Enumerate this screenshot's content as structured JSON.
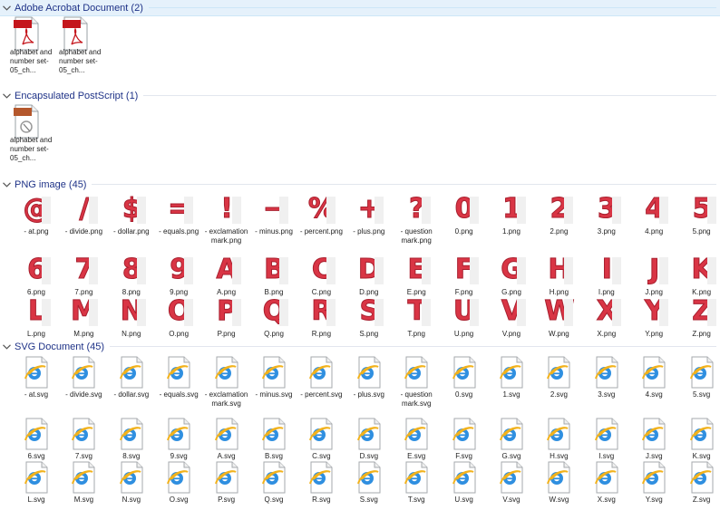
{
  "groups": [
    {
      "title": "Adobe Acrobat Document (2)"
    },
    {
      "title": "Encapsulated PostScript (1)"
    },
    {
      "title": "PNG image (45)"
    },
    {
      "title": "SVG Document (45)"
    }
  ],
  "pdf_items": [
    {
      "label": "alphabet and number set-05_ch...",
      "badge": "PDF"
    },
    {
      "label": "alphabet and number set-05_ch...",
      "badge": "PDF"
    }
  ],
  "eps_items": [
    {
      "label": "alphabet and number set-05_ch...",
      "badge": "EPS"
    }
  ],
  "png_items": [
    {
      "glyph": "@",
      "label": "- at.png"
    },
    {
      "glyph": "/",
      "label": "- divide.png"
    },
    {
      "glyph": "$",
      "label": "- dollar.png"
    },
    {
      "glyph": "=",
      "label": "- equals.png"
    },
    {
      "glyph": "!",
      "label": "- exclamation mark.png"
    },
    {
      "glyph": "−",
      "label": "- minus.png"
    },
    {
      "glyph": "%",
      "label": "- percent.png"
    },
    {
      "glyph": "+",
      "label": "- plus.png"
    },
    {
      "glyph": "?",
      "label": "- question mark.png"
    },
    {
      "glyph": "0",
      "label": "0.png"
    },
    {
      "glyph": "1",
      "label": "1.png"
    },
    {
      "glyph": "2",
      "label": "2.png"
    },
    {
      "glyph": "3",
      "label": "3.png"
    },
    {
      "glyph": "4",
      "label": "4.png"
    },
    {
      "glyph": "5",
      "label": "5.png"
    },
    {
      "glyph": "6",
      "label": "6.png"
    },
    {
      "glyph": "7",
      "label": "7.png"
    },
    {
      "glyph": "8",
      "label": "8.png"
    },
    {
      "glyph": "9",
      "label": "9.png"
    },
    {
      "glyph": "A",
      "label": "A.png"
    },
    {
      "glyph": "B",
      "label": "B.png"
    },
    {
      "glyph": "C",
      "label": "C.png"
    },
    {
      "glyph": "D",
      "label": "D.png"
    },
    {
      "glyph": "E",
      "label": "E.png"
    },
    {
      "glyph": "F",
      "label": "F.png"
    },
    {
      "glyph": "G",
      "label": "G.png"
    },
    {
      "glyph": "H",
      "label": "H.png"
    },
    {
      "glyph": "I",
      "label": "I.png"
    },
    {
      "glyph": "J",
      "label": "J.png"
    },
    {
      "glyph": "K",
      "label": "K.png"
    },
    {
      "glyph": "L",
      "label": "L.png"
    },
    {
      "glyph": "M",
      "label": "M.png"
    },
    {
      "glyph": "N",
      "label": "N.png"
    },
    {
      "glyph": "O",
      "label": "O.png"
    },
    {
      "glyph": "P",
      "label": "P.png"
    },
    {
      "glyph": "Q",
      "label": "Q.png"
    },
    {
      "glyph": "R",
      "label": "R.png"
    },
    {
      "glyph": "S",
      "label": "S.png"
    },
    {
      "glyph": "T",
      "label": "T.png"
    },
    {
      "glyph": "U",
      "label": "U.png"
    },
    {
      "glyph": "V",
      "label": "V.png"
    },
    {
      "glyph": "W",
      "label": "W.png"
    },
    {
      "glyph": "X",
      "label": "X.png"
    },
    {
      "glyph": "Y",
      "label": "Y.png"
    },
    {
      "glyph": "Z",
      "label": "Z.png"
    }
  ],
  "svg_items": [
    {
      "label": "- at.svg"
    },
    {
      "label": "- divide.svg"
    },
    {
      "label": "- dollar.svg"
    },
    {
      "label": "- equals.svg"
    },
    {
      "label": "- exclamation mark.svg"
    },
    {
      "label": "- minus.svg"
    },
    {
      "label": "- percent.svg"
    },
    {
      "label": "- plus.svg"
    },
    {
      "label": "- question mark.svg"
    },
    {
      "label": "0.svg"
    },
    {
      "label": "1.svg"
    },
    {
      "label": "2.svg"
    },
    {
      "label": "3.svg"
    },
    {
      "label": "4.svg"
    },
    {
      "label": "5.svg"
    },
    {
      "label": "6.svg"
    },
    {
      "label": "7.svg"
    },
    {
      "label": "8.svg"
    },
    {
      "label": "9.svg"
    },
    {
      "label": "A.svg"
    },
    {
      "label": "B.svg"
    },
    {
      "label": "C.svg"
    },
    {
      "label": "D.svg"
    },
    {
      "label": "E.svg"
    },
    {
      "label": "F.svg"
    },
    {
      "label": "G.svg"
    },
    {
      "label": "H.svg"
    },
    {
      "label": "I.svg"
    },
    {
      "label": "J.svg"
    },
    {
      "label": "K.svg"
    },
    {
      "label": "L.svg"
    },
    {
      "label": "M.svg"
    },
    {
      "label": "N.svg"
    },
    {
      "label": "O.svg"
    },
    {
      "label": "P.svg"
    },
    {
      "label": "Q.svg"
    },
    {
      "label": "R.svg"
    },
    {
      "label": "S.svg"
    },
    {
      "label": "T.svg"
    },
    {
      "label": "U.svg"
    },
    {
      "label": "V.svg"
    },
    {
      "label": "W.svg"
    },
    {
      "label": "X.svg"
    },
    {
      "label": "Y.svg"
    },
    {
      "label": "Z.svg"
    }
  ],
  "icons": {
    "group_toggle": "chevron-down-icon",
    "pdf": "pdf-file-icon",
    "eps": "eps-file-icon",
    "svg": "internet-explorer-file-icon"
  },
  "colors": {
    "header_text": "#1e3287",
    "glyph_red": "#d93545",
    "selected_header_bg": "#e5f1fb"
  }
}
